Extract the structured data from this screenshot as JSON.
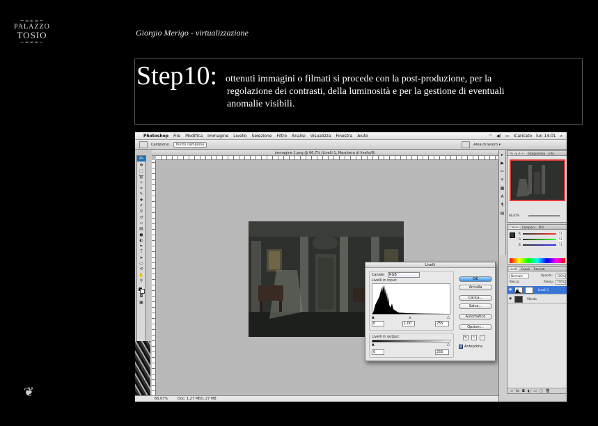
{
  "slide": {
    "logo": {
      "ornament_top": "~≈∞≈~",
      "line1": "PALAZZO",
      "line2": "TOSIO",
      "ornament_bottom": "~≈∞≈~"
    },
    "author": "Giorgio Merigo - virtualizzazione",
    "step_title": "Step10:",
    "step_lines": [
      "ottenuti immagini o filmati si procede con la post-produzione, per la",
      "regolazione dei contrasti, della luminosità e per la gestione di eventuali",
      "anomalie visibili."
    ],
    "footer_icon": "leaf-ornament-icon"
  },
  "photoshop": {
    "menubar": {
      "apple_icon": "apple-icon",
      "items": [
        "Photoshop",
        "File",
        "Modifica",
        "Immagine",
        "Livello",
        "Selezione",
        "Filtro",
        "Analisi",
        "Visualizza",
        "Finestra",
        "Aiuto"
      ],
      "user": "iCaricato",
      "clock": "lun 14:01"
    },
    "options": {
      "label": "Campione:",
      "select": "Punto campione",
      "workspace": "Area di lavoro ▾"
    },
    "document_title": "immagine 1.png @ 66,7% (Livelli 1, Maschera di livello/8)",
    "status": {
      "zoom": "66,67%",
      "doc": "Doc: 1,27 MB/1,27 MB"
    },
    "levels_dialog": {
      "title": "Livelli",
      "channel_label": "Canale:",
      "channel_value": "RGB",
      "input_label": "Livelli in input:",
      "input_values": [
        "0",
        "1,00",
        "255"
      ],
      "output_label": "Livelli in output:",
      "output_values": [
        "0",
        "255"
      ],
      "buttons": [
        "OK",
        "Annulla",
        "Carica...",
        "Salva...",
        "Automatico",
        "Opzioni..."
      ],
      "preview_label": "Anteprima",
      "preview_checked": true
    },
    "navigator": {
      "tabs": [
        "Navigatore",
        "Istogramma",
        "Info"
      ],
      "zoom": "66,67%"
    },
    "color_panel": {
      "tabs": [
        "Colore",
        "Campioni",
        "Stili"
      ],
      "channels": [
        "R",
        "G",
        "B"
      ],
      "values": [
        "51",
        "51",
        "51"
      ]
    },
    "layers_panel": {
      "tabs": [
        "Livelli",
        "Canali",
        "Tracciati"
      ],
      "blend_mode": "Normale",
      "opacity_label": "Opacità:",
      "opacity": "100%",
      "lock_label": "Blocca:",
      "fill_label": "Riemp.:",
      "fill": "100%",
      "layers": [
        "Livelli 1",
        "Sfondo"
      ]
    }
  }
}
